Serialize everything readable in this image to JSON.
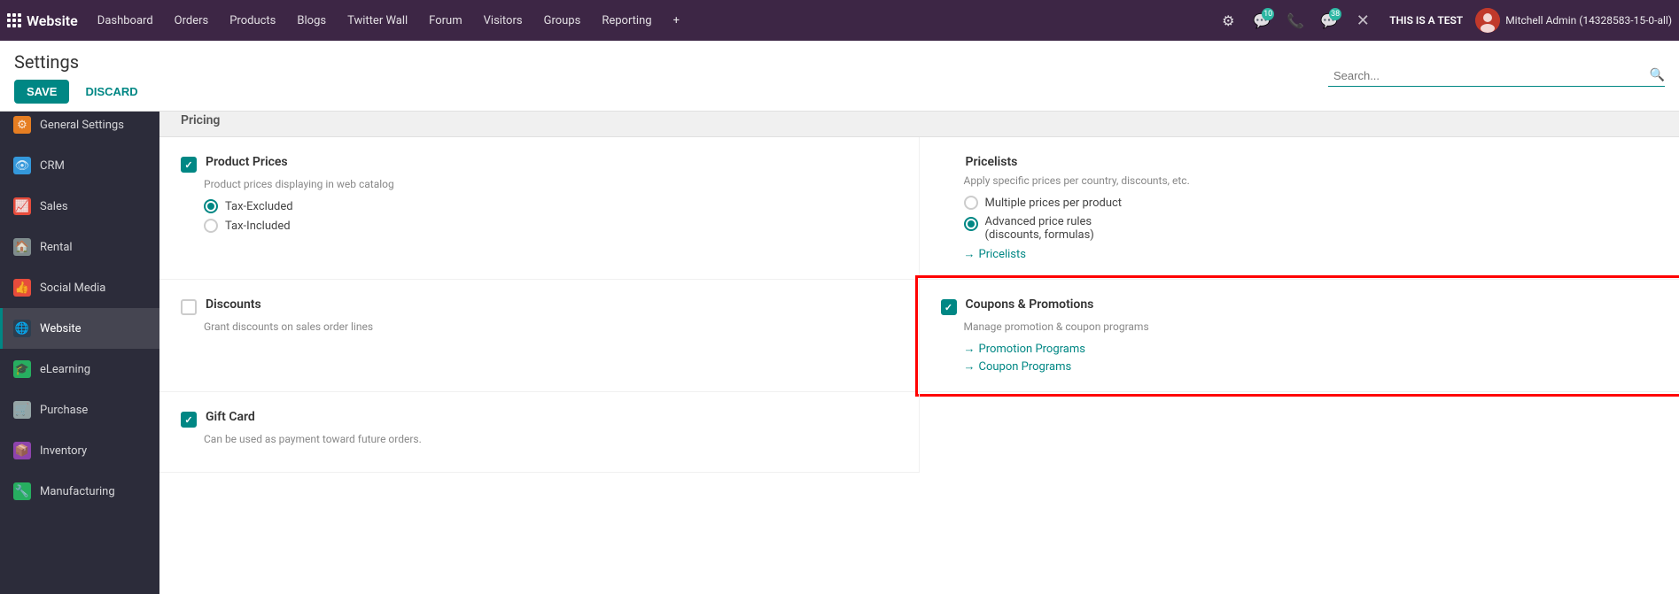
{
  "app": {
    "name": "Website"
  },
  "topnav": {
    "links": [
      {
        "id": "dashboard",
        "label": "Dashboard"
      },
      {
        "id": "orders",
        "label": "Orders"
      },
      {
        "id": "products",
        "label": "Products"
      },
      {
        "id": "blogs",
        "label": "Blogs"
      },
      {
        "id": "twitter-wall",
        "label": "Twitter Wall"
      },
      {
        "id": "forum",
        "label": "Forum"
      },
      {
        "id": "visitors",
        "label": "Visitors"
      },
      {
        "id": "groups",
        "label": "Groups"
      },
      {
        "id": "reporting",
        "label": "Reporting"
      }
    ],
    "badge_notifications": "10",
    "badge_calls": "38",
    "test_label": "THIS IS A TEST",
    "user_name": "Mitchell Admin (14328583-15-0-all)"
  },
  "page": {
    "title": "Settings",
    "save_label": "SAVE",
    "discard_label": "DISCARD",
    "search_placeholder": "Search..."
  },
  "sidebar": {
    "items": [
      {
        "id": "general-settings",
        "label": "General Settings",
        "icon": "⚙"
      },
      {
        "id": "crm",
        "label": "CRM",
        "icon": "👁"
      },
      {
        "id": "sales",
        "label": "Sales",
        "icon": "📈"
      },
      {
        "id": "rental",
        "label": "Rental",
        "icon": "🏠"
      },
      {
        "id": "social-media",
        "label": "Social Media",
        "icon": "👍"
      },
      {
        "id": "website",
        "label": "Website",
        "icon": "🌐",
        "active": true
      },
      {
        "id": "elearning",
        "label": "eLearning",
        "icon": "🎓"
      },
      {
        "id": "purchase",
        "label": "Purchase",
        "icon": "🛒"
      },
      {
        "id": "inventory",
        "label": "Inventory",
        "icon": "📦"
      },
      {
        "id": "manufacturing",
        "label": "Manufacturing",
        "icon": "⚙"
      }
    ]
  },
  "pricing": {
    "section_label": "Pricing",
    "product_prices": {
      "title": "Product Prices",
      "desc": "Product prices displaying in web catalog",
      "checked": true,
      "radio_options": [
        {
          "id": "tax-excluded",
          "label": "Tax-Excluded",
          "selected": true
        },
        {
          "id": "tax-included",
          "label": "Tax-Included",
          "selected": false
        }
      ]
    },
    "pricelists": {
      "title": "Pricelists",
      "desc": "Apply specific prices per country, discounts, etc.",
      "radio_options": [
        {
          "id": "multiple-prices",
          "label": "Multiple prices per product",
          "selected": false
        },
        {
          "id": "advanced-price-rules",
          "label": "Advanced price rules\n(discounts, formulas)",
          "selected": true
        }
      ],
      "link": {
        "label": "Pricelists",
        "arrow": "→"
      }
    },
    "discounts": {
      "title": "Discounts",
      "desc": "Grant discounts on sales order lines",
      "checked": false
    },
    "coupons_promotions": {
      "title": "Coupons & Promotions",
      "desc": "Manage promotion & coupon programs",
      "checked": true,
      "links": [
        {
          "id": "promotion-programs",
          "label": "Promotion Programs",
          "arrow": "→"
        },
        {
          "id": "coupon-programs",
          "label": "Coupon Programs",
          "arrow": "→"
        }
      ],
      "highlighted": true
    },
    "gift_card": {
      "title": "Gift Card",
      "desc": "Can be used as payment toward future orders.",
      "checked": true
    }
  }
}
